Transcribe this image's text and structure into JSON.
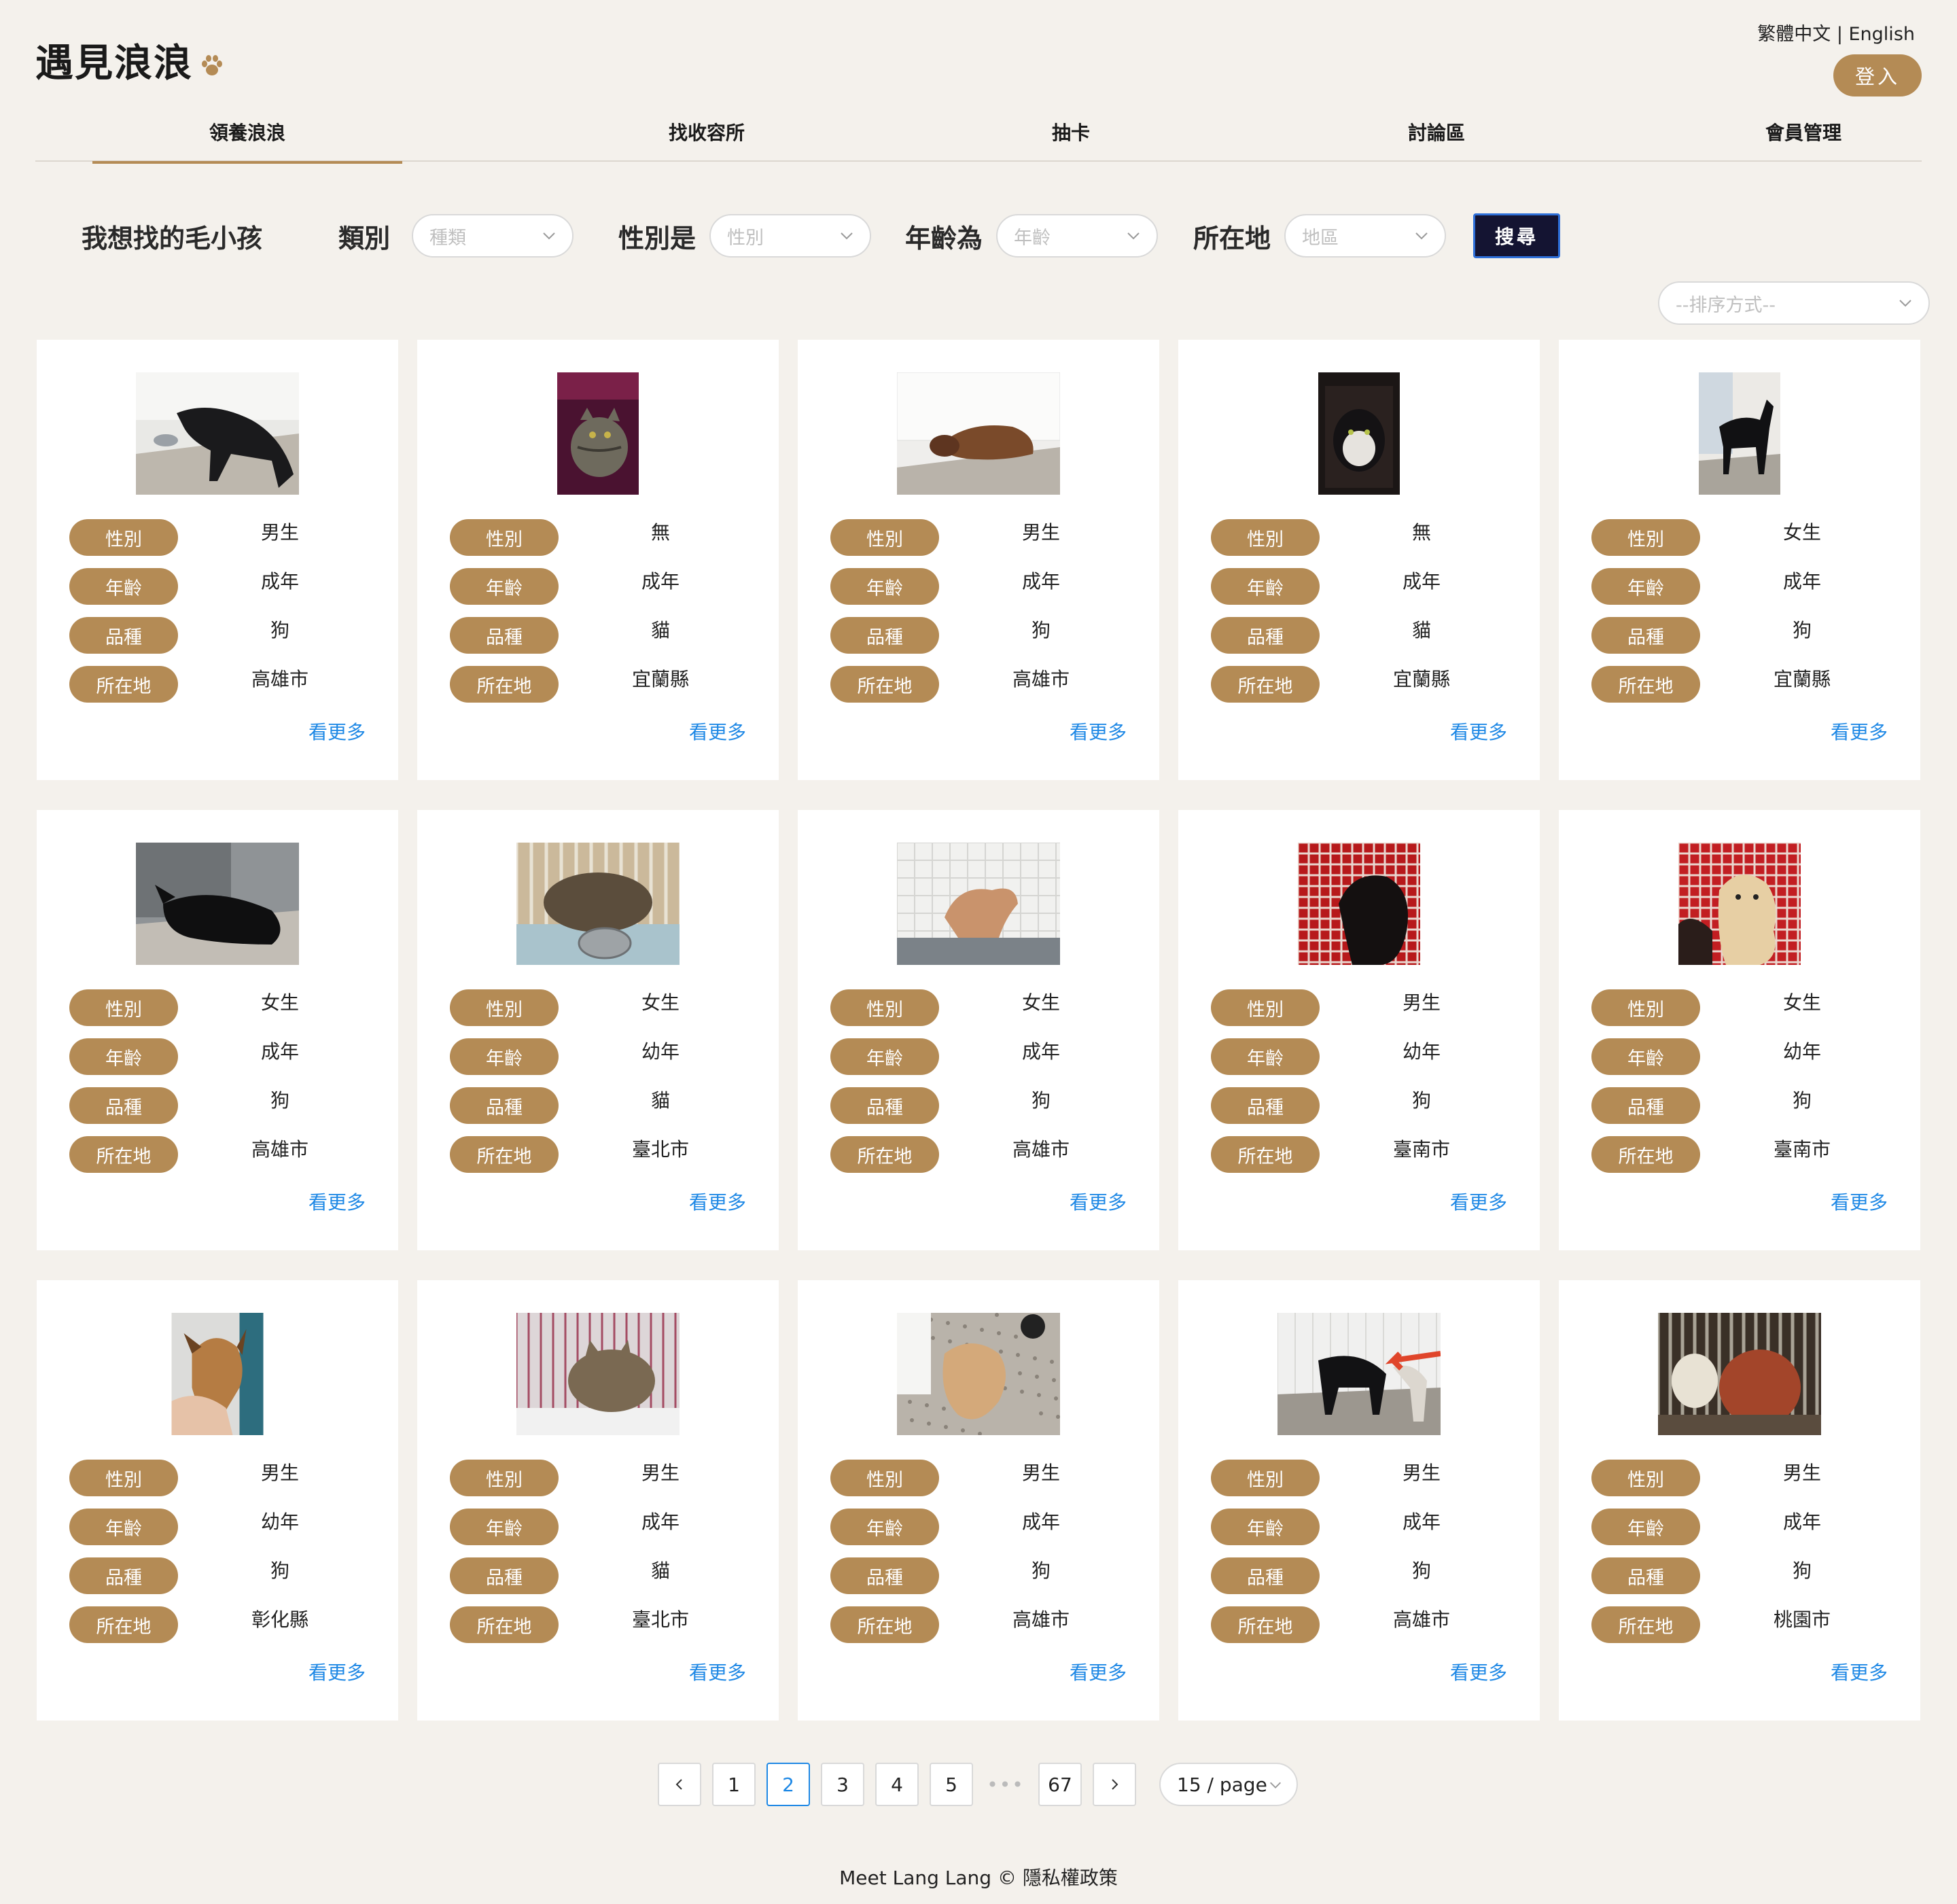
{
  "header": {
    "title": "遇見浪浪",
    "lang_zh": "繁體中文",
    "lang_sep": " | ",
    "lang_en": "English",
    "login": "登入"
  },
  "nav": [
    "領養浪浪",
    "找收容所",
    "抽卡",
    "討論區",
    "會員管理"
  ],
  "filter": {
    "heading": "我想找的毛小孩",
    "type_label": "類別",
    "type_placeholder": "種類",
    "gender_label": "性別是",
    "gender_placeholder": "性別",
    "age_label": "年齡為",
    "age_placeholder": "年齡",
    "location_label": "所在地",
    "location_placeholder": "地區",
    "search": "搜尋",
    "sort_placeholder": "--排序方式--"
  },
  "card_labels": {
    "gender": "性別",
    "age": "年齡",
    "breed": "品種",
    "location": "所在地",
    "more": "看更多"
  },
  "cards": [
    {
      "gender": "男生",
      "age": "成年",
      "breed": "狗",
      "location": "高雄市",
      "photo": "black-dog-bowl"
    },
    {
      "gender": "無",
      "age": "成年",
      "breed": "貓",
      "location": "宜蘭縣",
      "photo": "tabby-cat-dark"
    },
    {
      "gender": "男生",
      "age": "成年",
      "breed": "狗",
      "location": "高雄市",
      "photo": "brown-dog-lying"
    },
    {
      "gender": "無",
      "age": "成年",
      "breed": "貓",
      "location": "宜蘭縣",
      "photo": "black-white-cat"
    },
    {
      "gender": "女生",
      "age": "成年",
      "breed": "狗",
      "location": "宜蘭縣",
      "photo": "black-dog-standing"
    },
    {
      "gender": "女生",
      "age": "成年",
      "breed": "狗",
      "location": "高雄市",
      "photo": "black-dog-lying"
    },
    {
      "gender": "女生",
      "age": "幼年",
      "breed": "貓",
      "location": "臺北市",
      "photo": "tabby-kitten-cage"
    },
    {
      "gender": "女生",
      "age": "成年",
      "breed": "狗",
      "location": "高雄市",
      "photo": "tan-dog-sitting"
    },
    {
      "gender": "男生",
      "age": "幼年",
      "breed": "狗",
      "location": "臺南市",
      "photo": "black-puppy-red-wall"
    },
    {
      "gender": "女生",
      "age": "幼年",
      "breed": "狗",
      "location": "臺南市",
      "photo": "cream-puppy-red-wall"
    },
    {
      "gender": "男生",
      "age": "幼年",
      "breed": "狗",
      "location": "彰化縣",
      "photo": "brown-puppy-held"
    },
    {
      "gender": "男生",
      "age": "成年",
      "breed": "貓",
      "location": "臺北市",
      "photo": "tabby-cat-cage"
    },
    {
      "gender": "男生",
      "age": "成年",
      "breed": "狗",
      "location": "高雄市",
      "photo": "tan-dog-floor"
    },
    {
      "gender": "男生",
      "age": "成年",
      "breed": "狗",
      "location": "高雄市",
      "photo": "black-dog-arrow"
    },
    {
      "gender": "男生",
      "age": "成年",
      "breed": "狗",
      "location": "桃園市",
      "photo": "poodle-cage"
    }
  ],
  "pagination": {
    "pages": [
      "1",
      "2",
      "3",
      "4",
      "5",
      "67"
    ],
    "current": "2",
    "ellipsis": "•••",
    "page_size": "15 / page"
  },
  "footer": {
    "text": "Meet Lang Lang © ",
    "privacy": "隱私權政策"
  },
  "colors": {
    "accent": "#b48b55",
    "background": "#f4f1ec",
    "link": "#1e88e5",
    "search_button": "#141432"
  }
}
